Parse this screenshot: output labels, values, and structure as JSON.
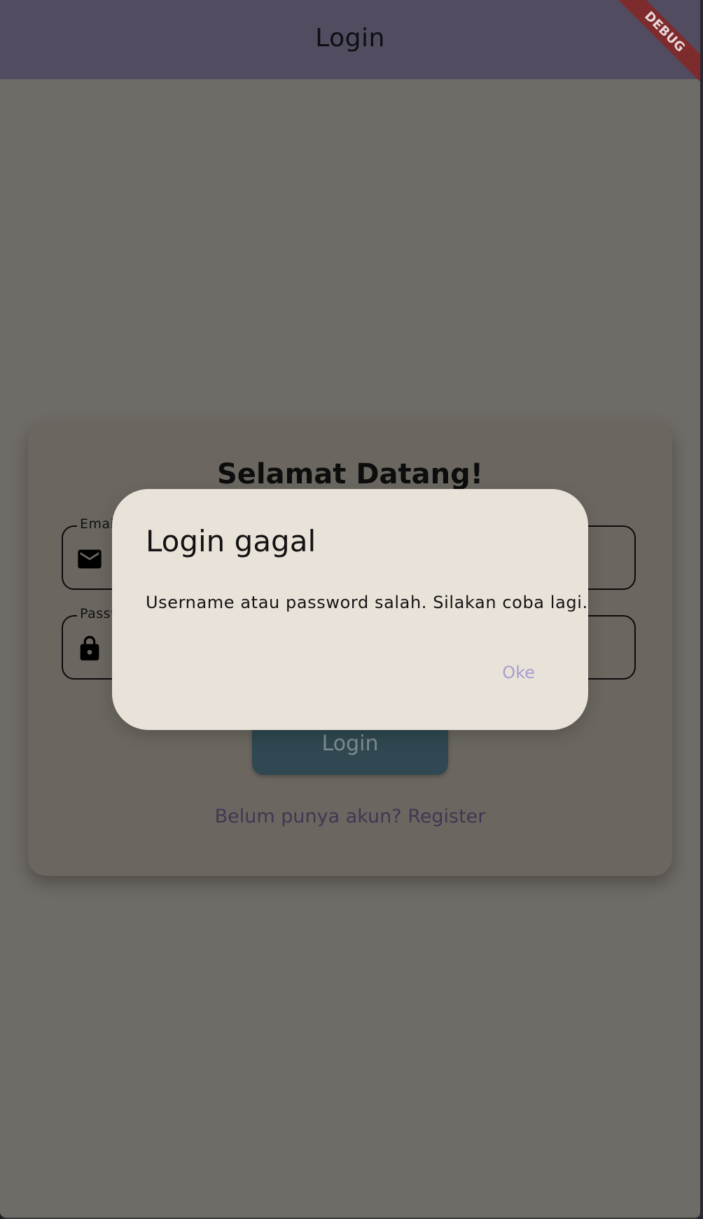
{
  "appbar": {
    "title": "Login",
    "debug_label": "DEBUG"
  },
  "card": {
    "title": "Selamat Datang!",
    "email_field": {
      "label": "Email",
      "icon": "mail-icon"
    },
    "password_field": {
      "label": "Password",
      "icon": "lock-icon"
    },
    "login_button_label": "Login",
    "register_link": "Belum punya akun? Register"
  },
  "dialog": {
    "title": "Login gagal",
    "message": "Username atau password salah. Silakan coba lagi.",
    "ok_label": "Oke"
  },
  "colors": {
    "appbar": "#514c5f",
    "scrim_background": "#6f6b66",
    "dialog_background": "#e8e2d9",
    "button": "#2f4851",
    "link": "#3f3852",
    "ok_text": "#a79fce",
    "debug_ribbon": "#7e2b2d"
  }
}
